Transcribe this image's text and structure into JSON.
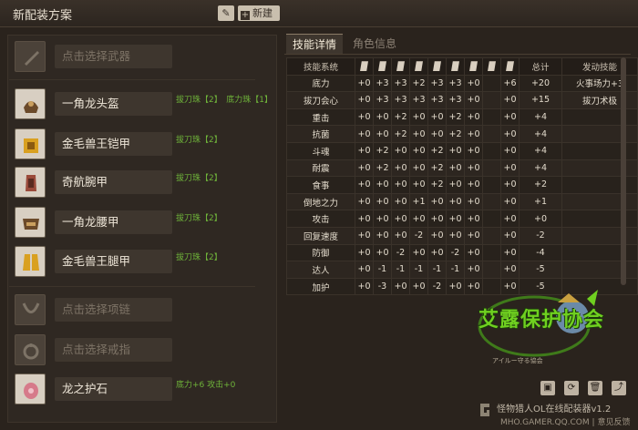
{
  "header": {
    "title": "新配装方案",
    "edit_icon": "pencil-icon",
    "new_label": "新建",
    "new_icon": "plus-icon"
  },
  "slots": [
    {
      "name": "点击选择武器",
      "placeholder": true,
      "icon": "weapon-slot-icon",
      "skills": ""
    },
    {
      "name": "一角龙头盔",
      "placeholder": false,
      "icon": "helmet-icon",
      "skills": "拔刀珠【2】　底力珠【1】"
    },
    {
      "name": "金毛兽王铠甲",
      "placeholder": false,
      "icon": "chest-armor-icon",
      "skills": "拔刀珠【2】"
    },
    {
      "name": "奇航腕甲",
      "placeholder": false,
      "icon": "arm-armor-icon",
      "skills": "拔刀珠【2】"
    },
    {
      "name": "一角龙腰甲",
      "placeholder": false,
      "icon": "waist-armor-icon",
      "skills": "拔刀珠【2】"
    },
    {
      "name": "金毛兽王腿甲",
      "placeholder": false,
      "icon": "leg-armor-icon",
      "skills": "拔刀珠【2】"
    },
    {
      "name": "点击选择项链",
      "placeholder": true,
      "icon": "necklace-icon",
      "skills": ""
    },
    {
      "name": "点击选择戒指",
      "placeholder": true,
      "icon": "ring-icon",
      "skills": ""
    },
    {
      "name": "龙之护石",
      "placeholder": false,
      "icon": "talisman-icon",
      "skills": "底力+6 攻击+0"
    }
  ],
  "tabs": {
    "skills": "技能详情",
    "character": "角色信息"
  },
  "table": {
    "header_first": "技能系统",
    "header_icons": [
      "weapon-icon",
      "helmet-icon",
      "chest-icon",
      "arm-icon",
      "waist-icon",
      "leg-icon",
      "necklace-icon",
      "ring-icon",
      "talisman-icon"
    ],
    "header_total": "总计",
    "header_active": "发动技能",
    "rows": [
      {
        "name": "底力",
        "vals": [
          "+0",
          "+3",
          "+3",
          "+2",
          "+3",
          "+3",
          "+0",
          "+6"
        ],
        "total": "+20",
        "active": "火事场力+3"
      },
      {
        "name": "拔刀会心",
        "vals": [
          "+0",
          "+3",
          "+3",
          "+3",
          "+3",
          "+3",
          "+0",
          "+0"
        ],
        "total": "+15",
        "active": "拔刀术极"
      },
      {
        "name": "重击",
        "vals": [
          "+0",
          "+0",
          "+2",
          "+0",
          "+0",
          "+2",
          "+0",
          "+0"
        ],
        "total": "+4",
        "active": ""
      },
      {
        "name": "抗菌",
        "vals": [
          "+0",
          "+0",
          "+2",
          "+0",
          "+0",
          "+2",
          "+0",
          "+0"
        ],
        "total": "+4",
        "active": ""
      },
      {
        "name": "斗魂",
        "vals": [
          "+0",
          "+2",
          "+0",
          "+0",
          "+2",
          "+0",
          "+0",
          "+0"
        ],
        "total": "+4",
        "active": ""
      },
      {
        "name": "耐震",
        "vals": [
          "+0",
          "+2",
          "+0",
          "+0",
          "+2",
          "+0",
          "+0",
          "+0"
        ],
        "total": "+4",
        "active": ""
      },
      {
        "name": "食事",
        "vals": [
          "+0",
          "+0",
          "+0",
          "+0",
          "+2",
          "+0",
          "+0",
          "+0"
        ],
        "total": "+2",
        "active": ""
      },
      {
        "name": "倒地之力",
        "vals": [
          "+0",
          "+0",
          "+0",
          "+1",
          "+0",
          "+0",
          "+0",
          "+0"
        ],
        "total": "+1",
        "active": ""
      },
      {
        "name": "攻击",
        "vals": [
          "+0",
          "+0",
          "+0",
          "+0",
          "+0",
          "+0",
          "+0",
          "+0"
        ],
        "total": "+0",
        "active": ""
      },
      {
        "name": "回复速度",
        "vals": [
          "+0",
          "+0",
          "+0",
          "-2",
          "+0",
          "+0",
          "+0",
          "+0"
        ],
        "total": "-2",
        "active": ""
      },
      {
        "name": "防御",
        "vals": [
          "+0",
          "+0",
          "-2",
          "+0",
          "+0",
          "-2",
          "+0",
          "+0"
        ],
        "total": "-4",
        "active": ""
      },
      {
        "name": "达人",
        "vals": [
          "+0",
          "-1",
          "-1",
          "-1",
          "-1",
          "-1",
          "+0",
          "+0"
        ],
        "total": "-5",
        "active": ""
      },
      {
        "name": "加护",
        "vals": [
          "+0",
          "-3",
          "+0",
          "+0",
          "-2",
          "+0",
          "+0",
          "+0"
        ],
        "total": "-5",
        "active": ""
      }
    ]
  },
  "logo": {
    "text": "艾露保护协会",
    "sub": "アイルー守る協会"
  },
  "actions": {
    "save_icon": "save-icon",
    "refresh_icon": "refresh-icon",
    "delete_icon": "trash-icon",
    "share_icon": "share-icon"
  },
  "footer": {
    "app_name": "怪物猎人OL在线配装器v1.2",
    "site": "MHO.GAMER.QQ.COM",
    "separator": "|",
    "feedback": "意见反馈"
  }
}
